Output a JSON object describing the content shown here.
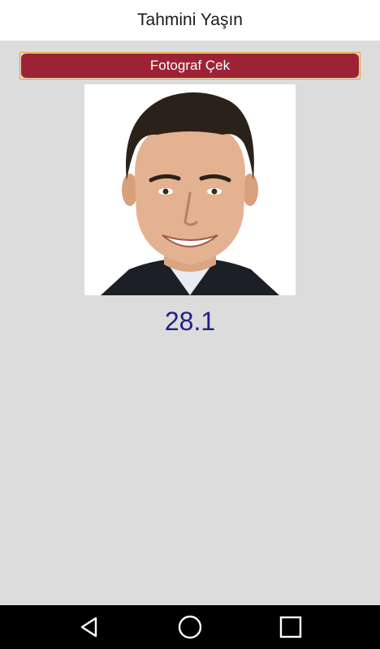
{
  "app": {
    "title": "Tahmini Yaşın"
  },
  "main": {
    "capture_button_label": "Fotograf Çek",
    "estimated_age": "28.1"
  },
  "navigation": {
    "back_icon": "triangle-back-icon",
    "home_icon": "circle-home-icon",
    "recents_icon": "square-recents-icon"
  },
  "colors": {
    "button_background": "#9b2335",
    "button_border": "#e0a030",
    "age_text": "#1f1f8a",
    "screen_background": "#dcdcdc"
  }
}
